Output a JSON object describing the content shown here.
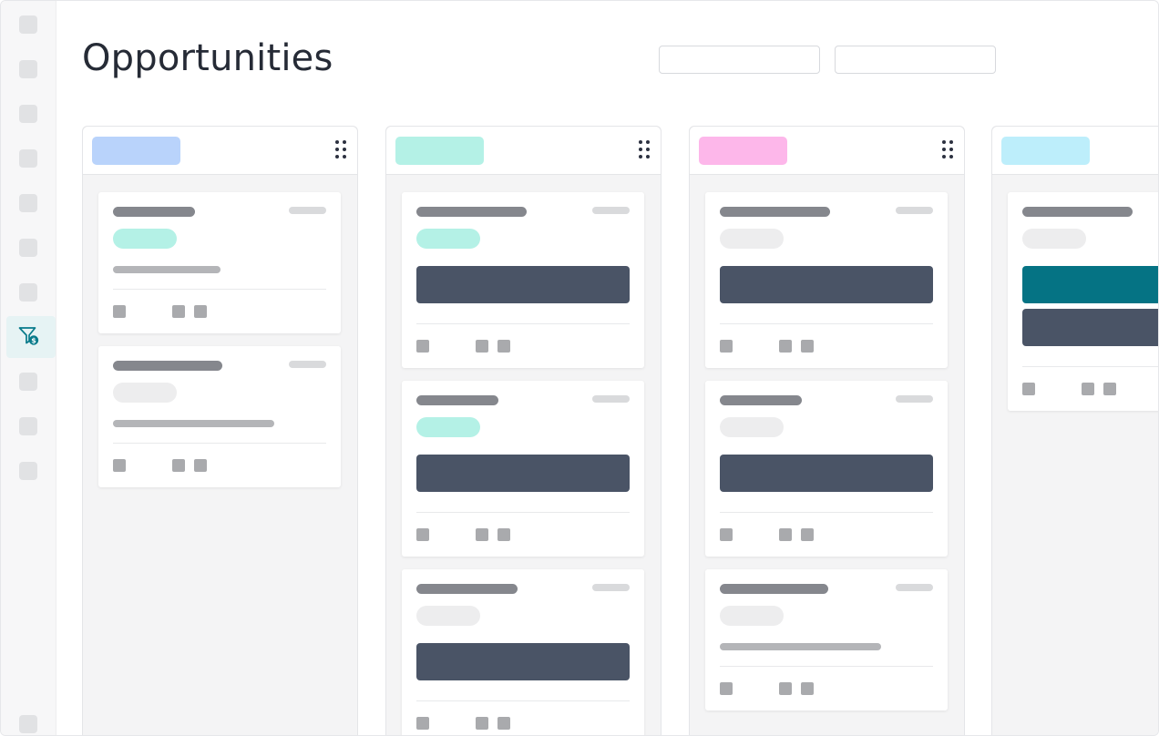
{
  "page": {
    "title": "Opportunities"
  },
  "filters": {
    "search_value": "",
    "sort_value": ""
  },
  "sidebar": {
    "active_icon": "funnel-dollar-icon",
    "accent_color": "#077a8a"
  },
  "columns": [
    {
      "tag_color": "#b9d3fb"
    },
    {
      "tag_color": "#b4f1e6"
    },
    {
      "tag_color": "#fdb7ea"
    },
    {
      "tag_color": "#bdeefb"
    }
  ],
  "colors": {
    "pill_green": "#b4f1e6",
    "pill_gray": "#ededee",
    "block_dark": "#4a5466",
    "block_teal": "#057384"
  }
}
